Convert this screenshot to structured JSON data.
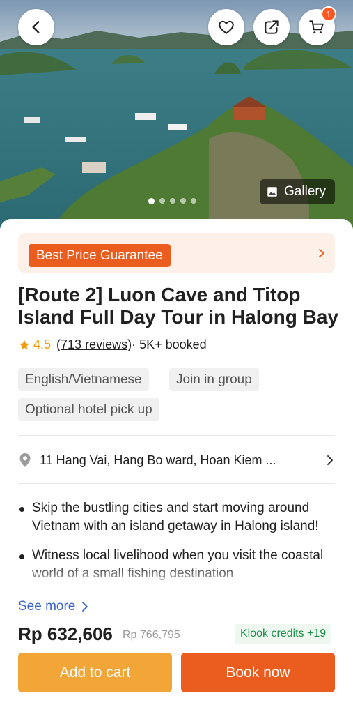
{
  "hero": {
    "gallery_label": "Gallery",
    "cart_count": "1",
    "slide_count": 5,
    "active_slide": 1
  },
  "promo": {
    "badge": "Best Price Guarantee"
  },
  "product": {
    "title": "[Route 2] Luon Cave and Titop Island Full Day Tour in Halong Bay",
    "rating": "4.5",
    "reviews_open": "(",
    "reviews": "713 reviews",
    "reviews_close": ")",
    "booked": " · 5K+ booked",
    "chips": [
      "English/Vietnamese",
      "Join in group",
      "Optional hotel pick up"
    ],
    "location": "11 Hang Vai, Hang Bo ward, Hoan Kiem ...",
    "highlights": [
      "Skip the bustling cities and start moving around Vietnam with an island getaway in Halong island!",
      "Witness local livelihood when you visit the coastal world of a small fishing destination"
    ],
    "see_more": "See more"
  },
  "footer": {
    "price": "Rp 632,606",
    "old_price": "Rp 766,795",
    "credits": "Klook credits +19",
    "add_to_cart": "Add to cart",
    "book_now": "Book now"
  },
  "colors": {
    "brand_orange": "#ea5d1e",
    "cart_yellow": "#f3a638",
    "link_blue": "#3a64c9",
    "credit_green": "#1e8f4a"
  }
}
